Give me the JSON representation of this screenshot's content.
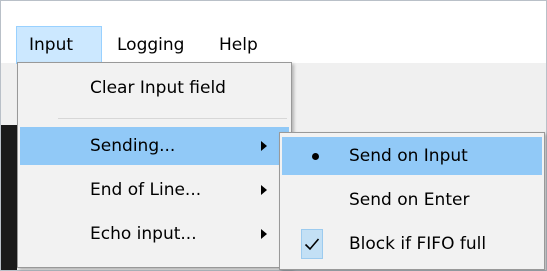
{
  "menubar": {
    "items": [
      {
        "label": "Input"
      },
      {
        "label": "Logging"
      },
      {
        "label": "Help"
      }
    ]
  },
  "input_menu": {
    "items": [
      {
        "label": "Clear Input field",
        "has_submenu": false
      },
      {
        "label": "Sending...",
        "has_submenu": true,
        "highlighted": true
      },
      {
        "label": "End of Line...",
        "has_submenu": true
      },
      {
        "label": "Echo input...",
        "has_submenu": true
      }
    ]
  },
  "sending_submenu": {
    "items": [
      {
        "label": "Send on Input",
        "mark": "radio-bullet",
        "selected": true,
        "highlighted": true
      },
      {
        "label": "Send on Enter",
        "mark": "none"
      },
      {
        "label": "Block if FIFO full",
        "mark": "checkmark",
        "checked": true
      }
    ]
  },
  "colors": {
    "highlight": "#91c9f7",
    "menubar_active": "#cce8ff",
    "check_bg": "#c3e0f5"
  }
}
